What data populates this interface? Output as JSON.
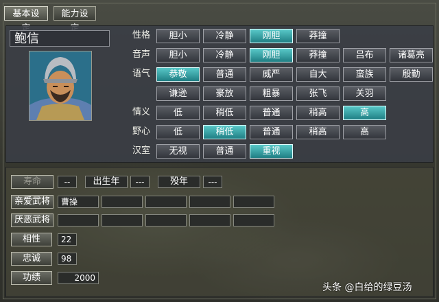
{
  "tabs": [
    {
      "label": "基本设定"
    },
    {
      "label": "能力设定"
    }
  ],
  "name": "鲍信",
  "rows": {
    "xingge": {
      "label": "性格",
      "options": [
        "胆小",
        "冷静",
        "刚胆",
        "莽撞"
      ],
      "selected": "刚胆"
    },
    "yinsheng": {
      "label": "音声",
      "options": [
        "胆小",
        "冷静",
        "刚胆",
        "莽撞",
        "吕布",
        "诸葛亮"
      ],
      "selected": "刚胆"
    },
    "yuqi": {
      "label": "语气",
      "options": [
        "恭敬",
        "普通",
        "威严",
        "自大",
        "蛮族",
        "殷勤",
        "谦逊",
        "豪放",
        "粗暴",
        "张飞",
        "关羽"
      ],
      "selected": "恭敬"
    },
    "qingyi": {
      "label": "情义",
      "options": [
        "低",
        "稍低",
        "普通",
        "稍高",
        "高"
      ],
      "selected": "高"
    },
    "yexin": {
      "label": "野心",
      "options": [
        "低",
        "稍低",
        "普通",
        "稍高",
        "高"
      ],
      "selected": "稍低"
    },
    "hanshi": {
      "label": "汉室",
      "options": [
        "无视",
        "普通",
        "重视"
      ],
      "selected": "重视"
    }
  },
  "bottom": {
    "shouming": {
      "label": "寿命",
      "value": "--"
    },
    "birth": {
      "label": "出生年",
      "value": "---"
    },
    "death": {
      "label": "殁年",
      "value": "---"
    },
    "qinai": {
      "label": "亲爱武将",
      "values": [
        "曹操",
        "",
        "",
        "",
        "",
        ""
      ]
    },
    "yanwu": {
      "label": "厌恶武将",
      "values": [
        "",
        "",
        "",
        "",
        "",
        ""
      ]
    },
    "xiangxing": {
      "label": "相性",
      "value": "22"
    },
    "zhongcheng": {
      "label": "忠诚",
      "value": "98"
    },
    "gongji": {
      "label": "功绩",
      "value": "2000"
    }
  },
  "watermark": "头条 @白给的绿豆汤",
  "colors": {
    "selected": "#3fb0b4",
    "panel": "#3a3e46"
  }
}
